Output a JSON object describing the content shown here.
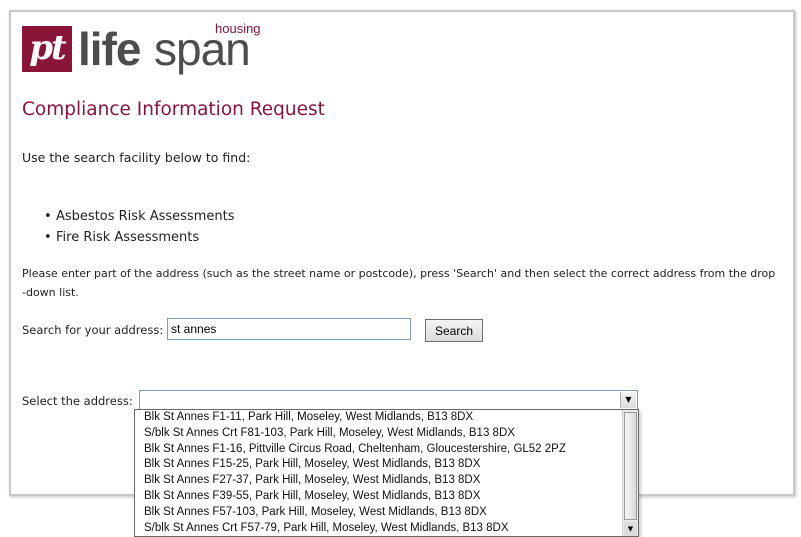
{
  "logo": {
    "mark": "pt",
    "life": "life",
    "span": "span",
    "housing": "housing",
    "brand_color": "#8a1538"
  },
  "page": {
    "title": "Compliance Information Request",
    "intro": "Use the search facility below to find:",
    "bullets": [
      "Asbestos Risk Assessments",
      "Fire Risk Assessments"
    ],
    "instructions": "Please enter part of the address (such as the street name or postcode), press 'Search' and then select the correct address from the drop -down list."
  },
  "search": {
    "label": "Search for your address:",
    "value": "st annes",
    "button_label": "Search"
  },
  "select": {
    "label": "Select the address:",
    "selected_value": "",
    "options": [
      "Blk St Annes F1-11, Park Hill, Moseley, West Midlands, B13 8DX",
      "S/blk St Annes Crt F81-103, Park Hill, Moseley, West Midlands, B13 8DX",
      "Blk St Annes F1-16, Pittville Circus Road, Cheltenham, Gloucestershire, GL52 2PZ",
      "Blk St Annes F15-25, Park Hill, Moseley, West Midlands, B13 8DX",
      "Blk St Annes F27-37, Park Hill, Moseley, West Midlands, B13 8DX",
      "Blk St Annes F39-55, Park Hill, Moseley, West Midlands, B13 8DX",
      "Blk St Annes F57-103, Park Hill, Moseley, West Midlands, B13 8DX",
      "S/blk St Annes Crt F57-79, Park Hill, Moseley, West Midlands, B13 8DX"
    ]
  }
}
